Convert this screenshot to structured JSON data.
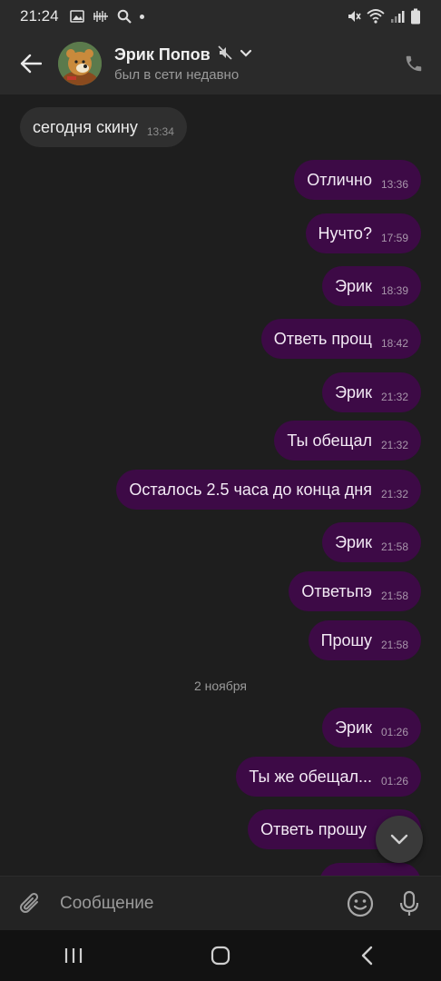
{
  "status_bar": {
    "time": "21:24",
    "left_icons": [
      "image-icon",
      "voicemail-icon",
      "search-icon",
      "dot-icon"
    ],
    "right_icons": [
      "mute-icon",
      "wifi-icon",
      "signal-icon",
      "battery-icon"
    ]
  },
  "header": {
    "contact_name": "Эрик Попов",
    "status": "был в сети недавно",
    "icons": [
      "back-arrow-icon",
      "muted-speaker-icon",
      "chevron-down-icon",
      "phone-icon"
    ]
  },
  "messages": [
    {
      "dir": "in",
      "text": "сегодня скину",
      "time": "13:34"
    },
    {
      "dir": "out",
      "text": "Отлично",
      "time": "13:36"
    },
    {
      "dir": "out",
      "text": "Нучто?",
      "time": "17:59"
    },
    {
      "dir": "out",
      "text": "Эрик",
      "time": "18:39"
    },
    {
      "dir": "out",
      "text": "Ответь прощ",
      "time": "18:42"
    },
    {
      "dir": "out",
      "text": "Эрик",
      "time": "21:32"
    },
    {
      "dir": "out",
      "text": "Ты обещал",
      "time": "21:32"
    },
    {
      "dir": "out",
      "text": "Осталось 2.5 часа до конца дня",
      "time": "21:32"
    },
    {
      "dir": "out",
      "text": "Эрик",
      "time": "21:58"
    },
    {
      "dir": "out",
      "text": "Ответьпэ",
      "time": "21:58"
    },
    {
      "dir": "out",
      "text": "Прошу",
      "time": "21:58"
    },
    {
      "dir": "out",
      "text": "Эрик",
      "time": "01:26"
    },
    {
      "dir": "out",
      "text": "Ты же обещал...",
      "time": "01:26"
    },
    {
      "dir": "out",
      "text": "Ответь прошу",
      "time": ""
    }
  ],
  "date_separator": "2 ноября",
  "composer": {
    "placeholder": "Сообщение"
  },
  "colors": {
    "outgoing_bubble": "#3d0a46",
    "incoming_bubble": "#2f2f2f",
    "background": "#1e1e1e",
    "header": "#2a2a2a"
  }
}
